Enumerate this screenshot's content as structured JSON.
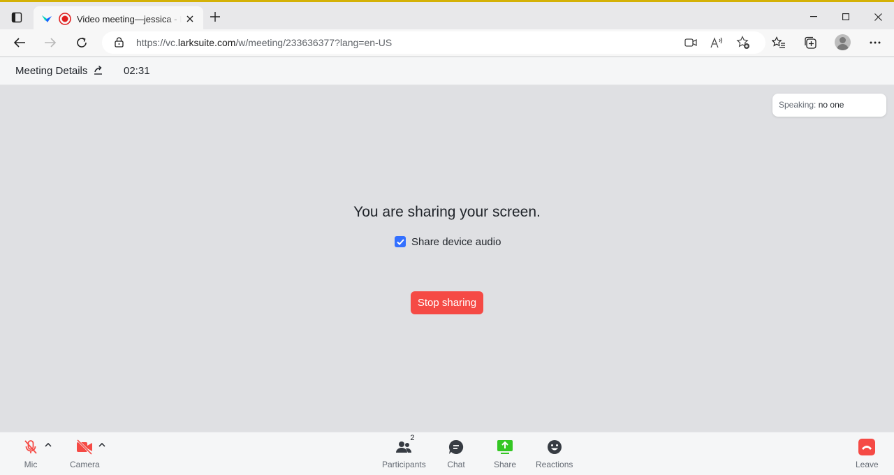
{
  "browser": {
    "tab_title": "Video meeting—jessica - Lark",
    "url_prefix": "https://vc.",
    "url_domain": "larksuite.com",
    "url_path": "/w/meeting/233636377?lang=en-US"
  },
  "meeting_header": {
    "title": "Meeting Details",
    "elapsed": "02:31"
  },
  "speaking": {
    "label": "Speaking:",
    "value": "no one"
  },
  "sharing": {
    "message": "You are sharing your screen.",
    "audio_label": "Share device audio",
    "audio_checked": true,
    "stop_label": "Stop sharing"
  },
  "toolbar": {
    "mic": "Mic",
    "camera": "Camera",
    "participants": "Participants",
    "participant_count": "2",
    "chat": "Chat",
    "share": "Share",
    "reactions": "Reactions",
    "leave": "Leave"
  },
  "colors": {
    "accent_blue": "#3370ff",
    "danger_red": "#f54a45",
    "share_green": "#34c724",
    "stage_bg": "#dfe0e3"
  }
}
